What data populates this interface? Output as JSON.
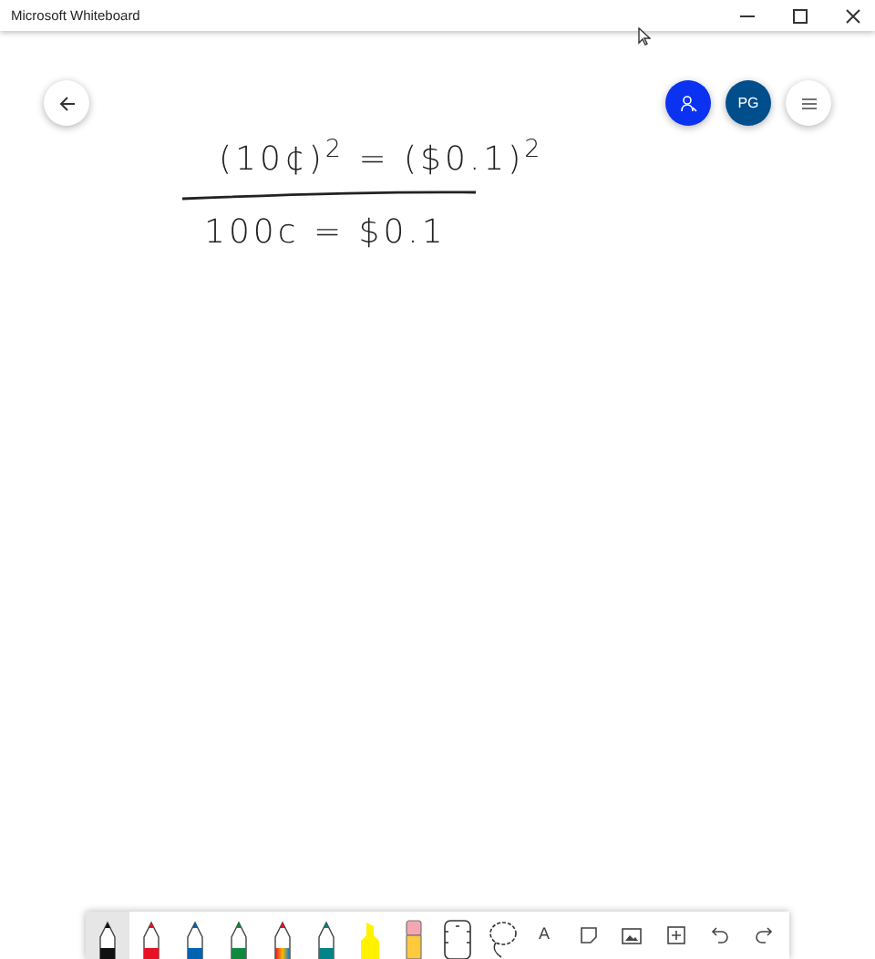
{
  "window": {
    "title": "Microsoft Whiteboard"
  },
  "header": {
    "initials": "PG"
  },
  "ink": [
    {
      "kind": "line",
      "text": "(10¢)$^{2}$ = ($0.1)$^{2}$"
    },
    {
      "kind": "rule"
    },
    {
      "kind": "line",
      "text": "100c = $0.1"
    }
  ],
  "tools": [
    {
      "kind": "pen",
      "color": "#111111",
      "selected": true
    },
    {
      "kind": "pen",
      "color": "#e81123",
      "selected": false
    },
    {
      "kind": "pen",
      "color": "#0063b1",
      "selected": false
    },
    {
      "kind": "pen",
      "color": "#10893e",
      "selected": false
    },
    {
      "kind": "rainbow-pen",
      "selected": false
    },
    {
      "kind": "pen",
      "color": "#038387",
      "selected": false
    },
    {
      "kind": "highlighter",
      "color": "#fff100",
      "selected": false
    },
    {
      "kind": "eraser",
      "selected": false
    },
    {
      "kind": "ruler",
      "selected": false
    },
    {
      "kind": "lasso",
      "selected": false
    },
    {
      "kind": "text",
      "label": "A",
      "selected": false
    },
    {
      "kind": "note",
      "selected": false
    },
    {
      "kind": "image",
      "selected": false
    },
    {
      "kind": "add",
      "selected": false
    },
    {
      "kind": "undo",
      "selected": false
    },
    {
      "kind": "redo",
      "selected": false
    }
  ]
}
